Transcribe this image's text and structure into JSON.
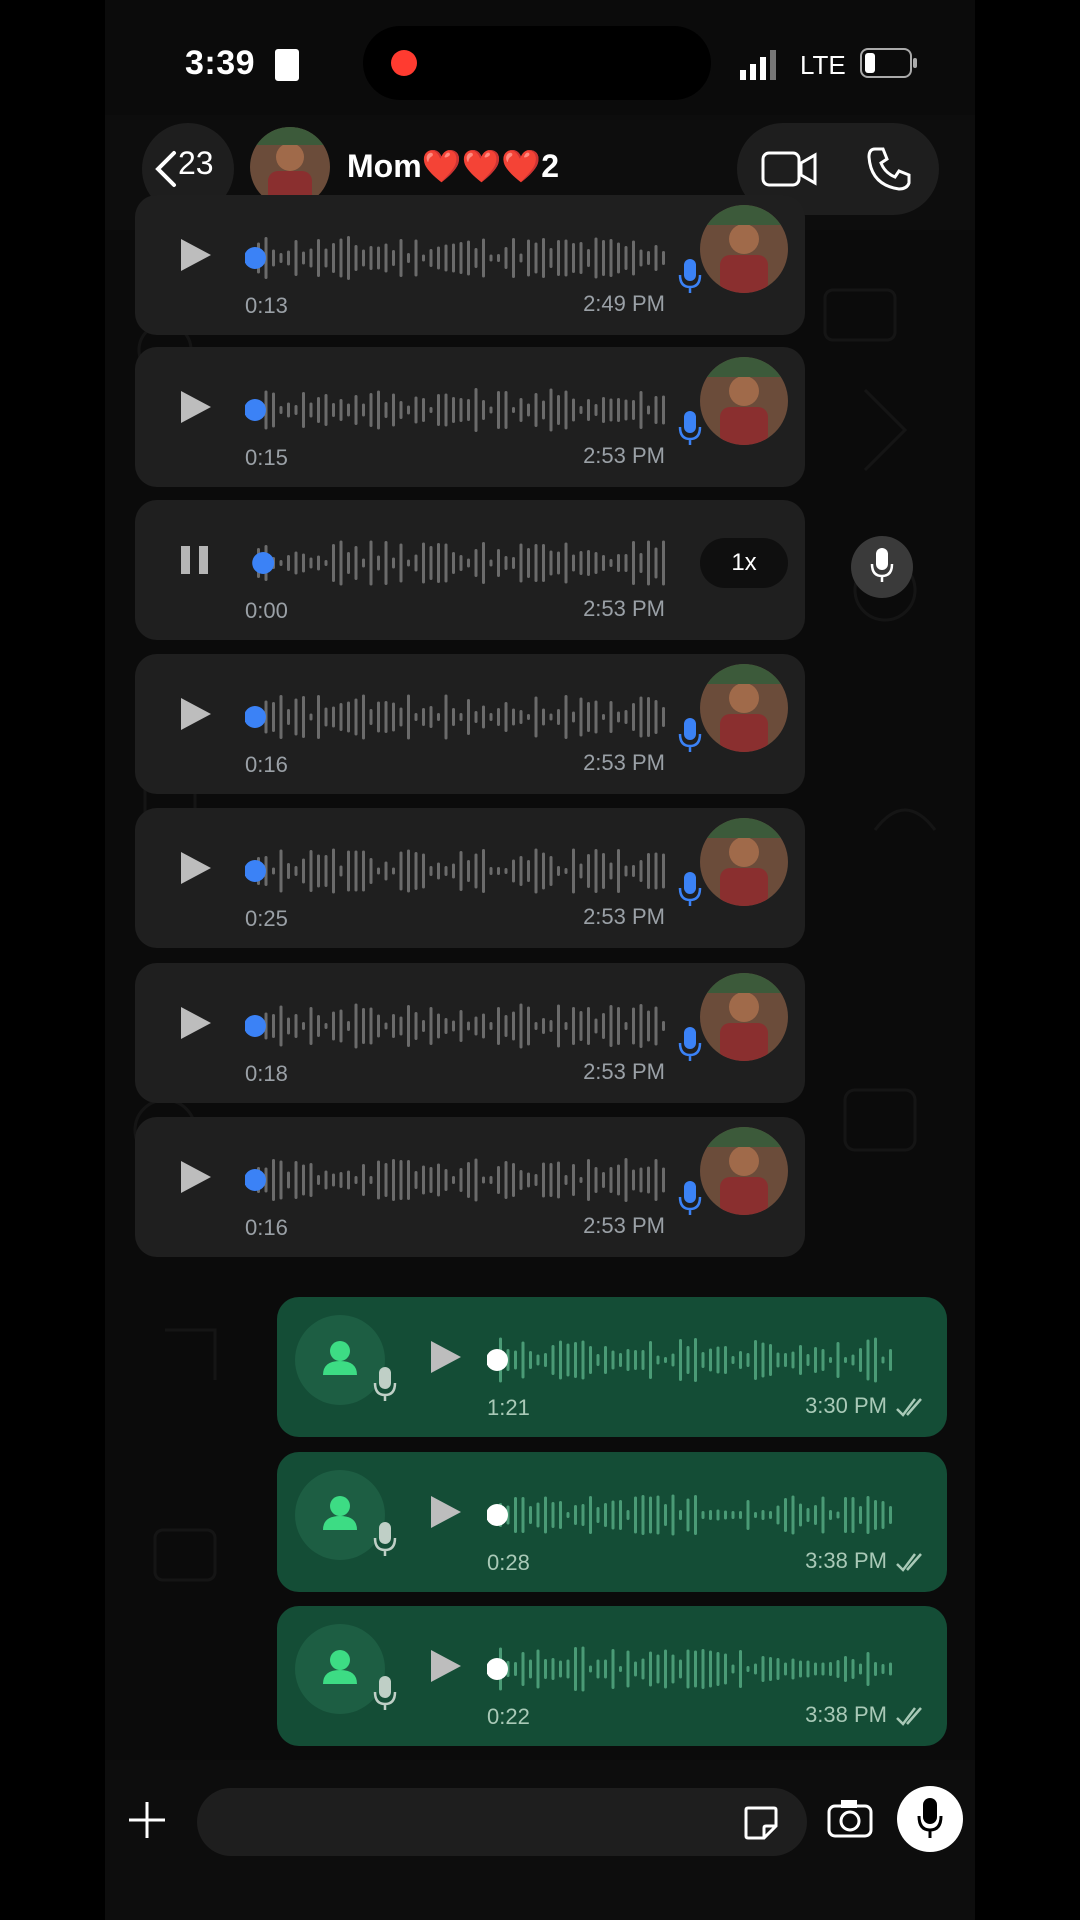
{
  "status_bar": {
    "time": "3:39",
    "network": "LTE"
  },
  "header": {
    "back_count": "23",
    "contact_name": "Mom❤️❤️❤️2"
  },
  "messages": [
    {
      "direction": "in",
      "duration": "0:13",
      "time": "2:49 PM",
      "progress": 0
    },
    {
      "direction": "in",
      "duration": "0:15",
      "time": "2:53 PM",
      "progress": 0
    },
    {
      "direction": "in",
      "duration": "0:00",
      "time": "2:53 PM",
      "progress": 0.02,
      "playing": true,
      "speed": "1x"
    },
    {
      "direction": "in",
      "duration": "0:16",
      "time": "2:53 PM",
      "progress": 0
    },
    {
      "direction": "in",
      "duration": "0:25",
      "time": "2:53 PM",
      "progress": 0
    },
    {
      "direction": "in",
      "duration": "0:18",
      "time": "2:53 PM",
      "progress": 0
    },
    {
      "direction": "in",
      "duration": "0:16",
      "time": "2:53 PM",
      "progress": 0
    },
    {
      "direction": "out",
      "duration": "1:21",
      "time": "3:30 PM",
      "progress": 0
    },
    {
      "direction": "out",
      "duration": "0:28",
      "time": "3:38 PM",
      "progress": 0
    },
    {
      "direction": "out",
      "duration": "0:22",
      "time": "3:38 PM",
      "progress": 0
    }
  ],
  "colors": {
    "accent_blue": "#3b82f6",
    "out_bubble": "#144d36",
    "in_bubble": "#1f1f1f"
  }
}
